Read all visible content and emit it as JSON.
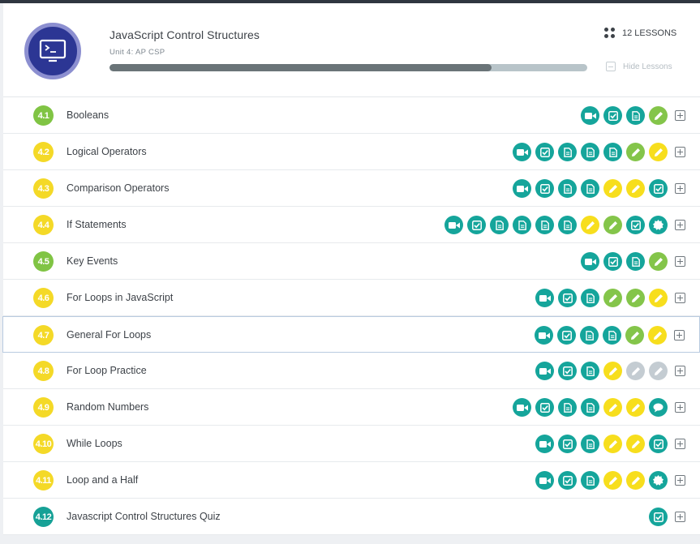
{
  "unit": {
    "title": "JavaScript Control Structures",
    "subtitle": "Unit 4: AP CSP",
    "progress": 0.8,
    "lesson_count_label": "12 LESSONS",
    "hide_label": "Hide Lessons",
    "logo_icon": "terminal-icon"
  },
  "colors": {
    "teal": "#15a59b",
    "yellow": "#f7de1d",
    "green": "#84c54a",
    "grey": "#c4ccd2"
  },
  "lessons": [
    {
      "number": "4.1",
      "title": "Booleans",
      "badge": "green",
      "activities": [
        [
          "video",
          "teal"
        ],
        [
          "check",
          "teal"
        ],
        [
          "doc",
          "teal"
        ],
        [
          "pencil",
          "green"
        ]
      ]
    },
    {
      "number": "4.2",
      "title": "Logical Operators",
      "badge": "yellow",
      "activities": [
        [
          "video",
          "teal"
        ],
        [
          "check",
          "teal"
        ],
        [
          "doc",
          "teal"
        ],
        [
          "doc",
          "teal"
        ],
        [
          "doc",
          "teal"
        ],
        [
          "pencil",
          "green"
        ],
        [
          "pencil",
          "yellow"
        ]
      ]
    },
    {
      "number": "4.3",
      "title": "Comparison Operators",
      "badge": "yellow",
      "activities": [
        [
          "video",
          "teal"
        ],
        [
          "check",
          "teal"
        ],
        [
          "doc",
          "teal"
        ],
        [
          "doc",
          "teal"
        ],
        [
          "pencil",
          "yellow"
        ],
        [
          "pencil",
          "yellow"
        ],
        [
          "check",
          "teal"
        ]
      ]
    },
    {
      "number": "4.4",
      "title": "If Statements",
      "badge": "yellow",
      "activities": [
        [
          "video",
          "teal"
        ],
        [
          "check",
          "teal"
        ],
        [
          "doc",
          "teal"
        ],
        [
          "doc",
          "teal"
        ],
        [
          "doc",
          "teal"
        ],
        [
          "doc",
          "teal"
        ],
        [
          "pencil",
          "yellow"
        ],
        [
          "pencil",
          "green"
        ],
        [
          "check",
          "teal"
        ],
        [
          "badge",
          "teal"
        ]
      ]
    },
    {
      "number": "4.5",
      "title": "Key Events",
      "badge": "green",
      "activities": [
        [
          "video",
          "teal"
        ],
        [
          "check",
          "teal"
        ],
        [
          "doc",
          "teal"
        ],
        [
          "pencil",
          "green"
        ]
      ]
    },
    {
      "number": "4.6",
      "title": "For Loops in JavaScript",
      "badge": "yellow",
      "activities": [
        [
          "video",
          "teal"
        ],
        [
          "check",
          "teal"
        ],
        [
          "doc",
          "teal"
        ],
        [
          "pencil",
          "green"
        ],
        [
          "pencil",
          "green"
        ],
        [
          "pencil",
          "yellow"
        ]
      ]
    },
    {
      "number": "4.7",
      "title": "General For Loops",
      "badge": "yellow",
      "activities": [
        [
          "video",
          "teal"
        ],
        [
          "check",
          "teal"
        ],
        [
          "doc",
          "teal"
        ],
        [
          "doc",
          "teal"
        ],
        [
          "pencil",
          "green"
        ],
        [
          "pencil",
          "yellow"
        ]
      ]
    },
    {
      "number": "4.8",
      "title": "For Loop Practice",
      "badge": "yellow",
      "activities": [
        [
          "video",
          "teal"
        ],
        [
          "check",
          "teal"
        ],
        [
          "doc",
          "teal"
        ],
        [
          "pencil",
          "yellow"
        ],
        [
          "pencil",
          "grey"
        ],
        [
          "pencil",
          "grey"
        ]
      ]
    },
    {
      "number": "4.9",
      "title": "Random Numbers",
      "badge": "yellow",
      "activities": [
        [
          "video",
          "teal"
        ],
        [
          "check",
          "teal"
        ],
        [
          "doc",
          "teal"
        ],
        [
          "doc",
          "teal"
        ],
        [
          "pencil",
          "yellow"
        ],
        [
          "pencil",
          "yellow"
        ],
        [
          "chat",
          "teal"
        ]
      ]
    },
    {
      "number": "4.10",
      "title": "While Loops",
      "badge": "yellow",
      "activities": [
        [
          "video",
          "teal"
        ],
        [
          "check",
          "teal"
        ],
        [
          "doc",
          "teal"
        ],
        [
          "pencil",
          "yellow"
        ],
        [
          "pencil",
          "yellow"
        ],
        [
          "check",
          "teal"
        ]
      ]
    },
    {
      "number": "4.11",
      "title": "Loop and a Half",
      "badge": "yellow",
      "activities": [
        [
          "video",
          "teal"
        ],
        [
          "check",
          "teal"
        ],
        [
          "doc",
          "teal"
        ],
        [
          "pencil",
          "yellow"
        ],
        [
          "pencil",
          "yellow"
        ],
        [
          "badge",
          "teal"
        ]
      ]
    },
    {
      "number": "4.12",
      "title": "Javascript Control Structures Quiz",
      "badge": "teal",
      "activities": [
        [
          "check",
          "teal"
        ]
      ]
    }
  ]
}
